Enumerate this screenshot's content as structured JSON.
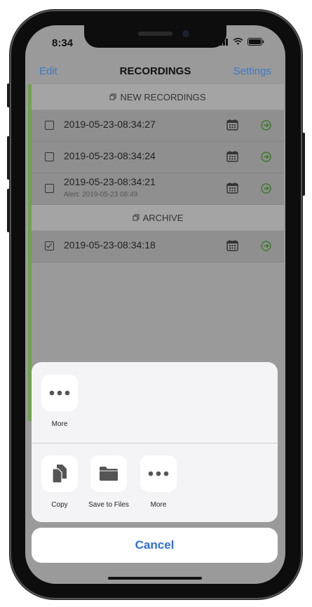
{
  "status_bar": {
    "time": "8:34"
  },
  "nav": {
    "left": "Edit",
    "title": "RECORDINGS",
    "right": "Settings"
  },
  "sections": {
    "new": "NEW RECORDINGS",
    "archive": "ARCHIVE"
  },
  "recordings": [
    {
      "name": "2019-05-23-08:34:27",
      "alert": ""
    },
    {
      "name": "2019-05-23-08:34:24",
      "alert": ""
    },
    {
      "name": "2019-05-23-08:34:21",
      "alert": "Alert: 2019-05-23 08:49"
    }
  ],
  "archive": [
    {
      "name": "2019-05-23-08:34:18",
      "checked": true
    }
  ],
  "share_sheet": {
    "top": [
      {
        "label": "More",
        "icon": "more-icon"
      }
    ],
    "actions": [
      {
        "label": "Copy",
        "icon": "copy-icon"
      },
      {
        "label": "Save to Files",
        "icon": "folder-icon"
      },
      {
        "label": "More",
        "icon": "more-icon"
      }
    ],
    "cancel": "Cancel"
  },
  "colors": {
    "accent": "#2f6fd6",
    "green": "#6fa24a"
  }
}
